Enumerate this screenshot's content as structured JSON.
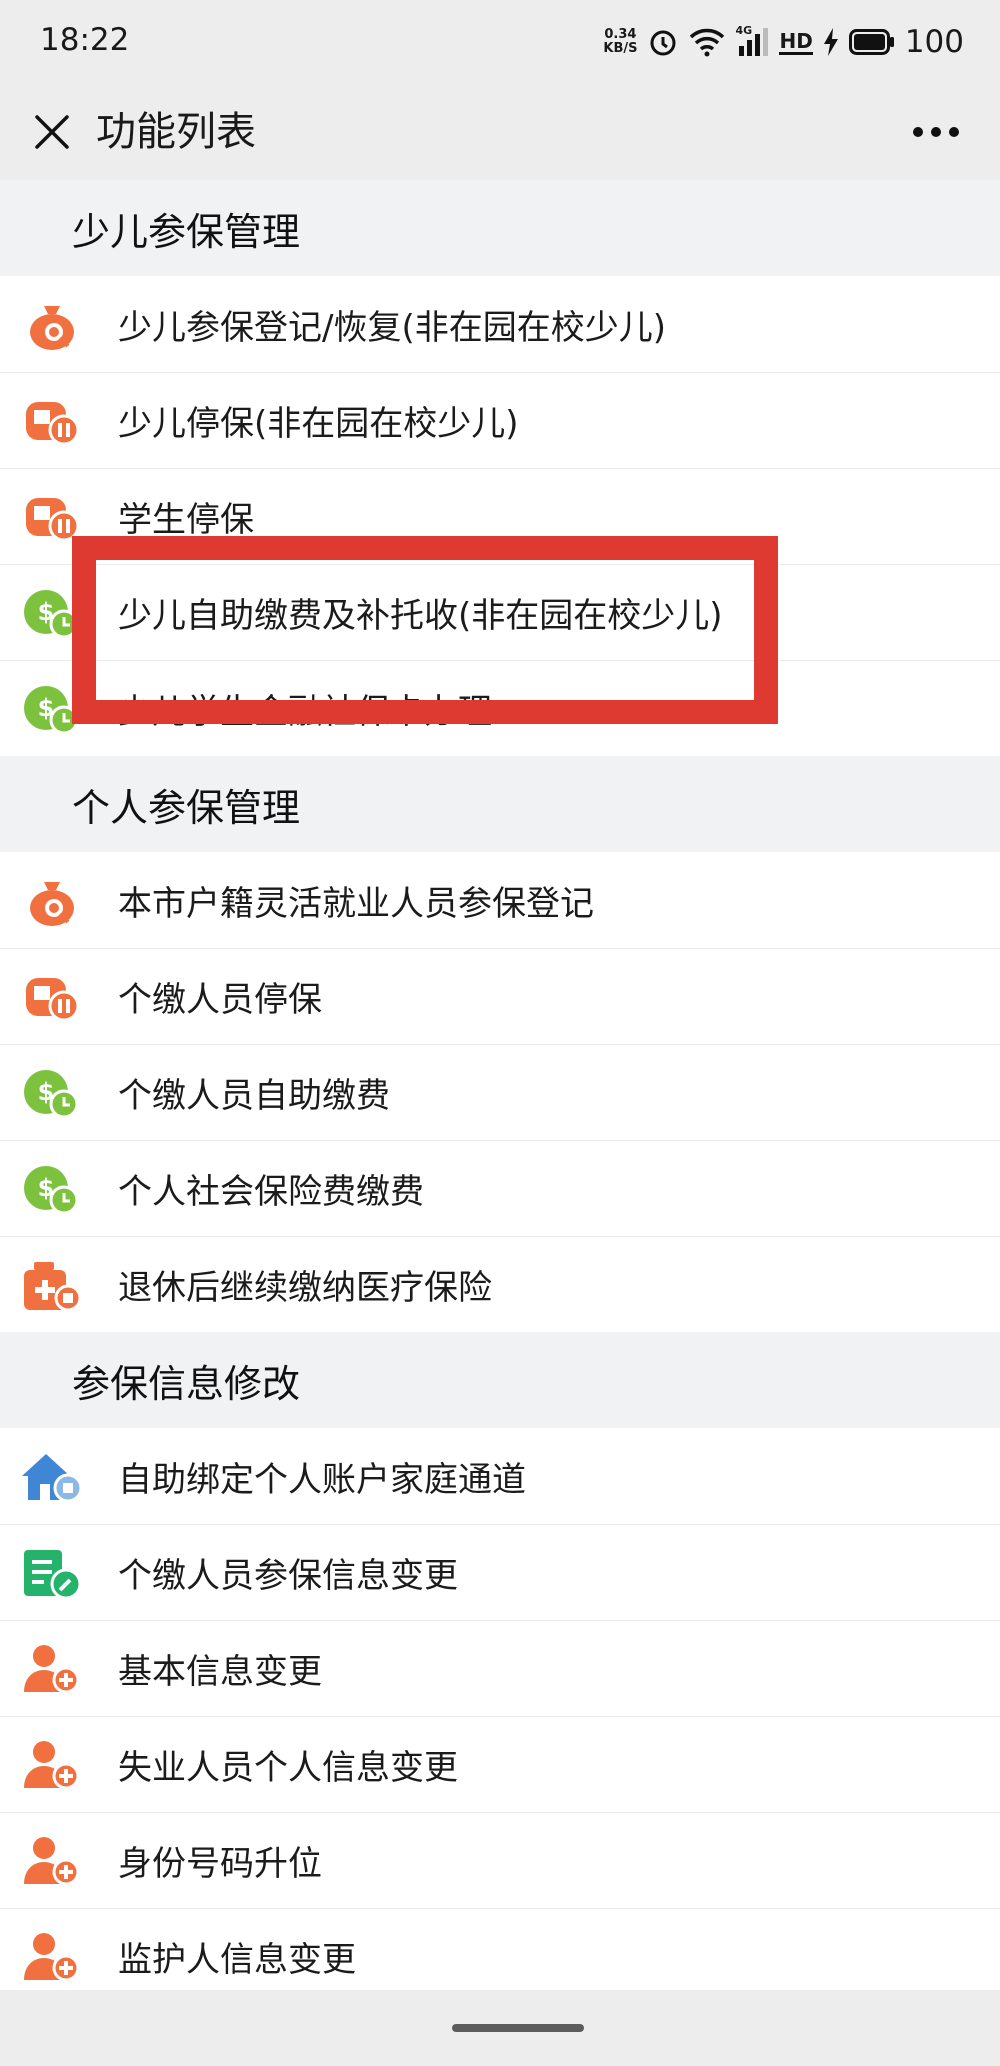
{
  "status_bar": {
    "time": "18:22",
    "net_speed_value": "0.34",
    "net_speed_unit": "KB/S",
    "network_type": "4G",
    "hd_label": "HD",
    "battery": "100",
    "icons": [
      "alarm-icon",
      "wifi-icon",
      "signal-icon",
      "hd-icon",
      "charging-icon",
      "battery-icon"
    ]
  },
  "nav": {
    "title": "功能列表",
    "close_icon": "close-icon",
    "more_icon": "more-icon"
  },
  "colors": {
    "orange": "#f07040",
    "green": "#7cc23e",
    "blue": "#3f86d4",
    "teal": "#25b26b",
    "highlight_border": "#de3a32",
    "section_bg": "#f1f2f4"
  },
  "sections": [
    {
      "title": "少儿参保管理",
      "items": [
        {
          "label": "少儿参保登记/恢复(非在园在校少儿)",
          "icon": "money-bag-icon"
        },
        {
          "label": "少儿停保(非在园在校少儿)",
          "icon": "pause-insurance-icon"
        },
        {
          "label": "学生停保",
          "icon": "pause-insurance-icon"
        },
        {
          "label": "少儿自助缴费及补托收(非在园在校少儿)",
          "icon": "coin-clock-icon"
        },
        {
          "label": "少儿学生金融社保卡办理",
          "icon": "coin-clock-icon"
        }
      ]
    },
    {
      "title": "个人参保管理",
      "items": [
        {
          "label": "本市户籍灵活就业人员参保登记",
          "icon": "money-bag-icon"
        },
        {
          "label": "个缴人员停保",
          "icon": "pause-insurance-icon"
        },
        {
          "label": "个缴人员自助缴费",
          "icon": "coin-clock-icon"
        },
        {
          "label": "个人社会保险费缴费",
          "icon": "coin-clock-icon"
        },
        {
          "label": "退休后继续缴纳医疗保险",
          "icon": "medical-kit-icon"
        }
      ]
    },
    {
      "title": "参保信息修改",
      "items": [
        {
          "label": "自助绑定个人账户家庭通道",
          "icon": "house-icon"
        },
        {
          "label": "个缴人员参保信息变更",
          "icon": "edit-form-icon"
        },
        {
          "label": "基本信息变更",
          "icon": "user-settings-icon"
        },
        {
          "label": "失业人员个人信息变更",
          "icon": "user-settings-icon"
        },
        {
          "label": "身份号码升位",
          "icon": "user-settings-icon"
        },
        {
          "label": "监护人信息变更",
          "icon": "user-settings-icon"
        }
      ]
    }
  ],
  "highlight_target": "少儿自助缴费及补托收(非在园在校少儿)"
}
